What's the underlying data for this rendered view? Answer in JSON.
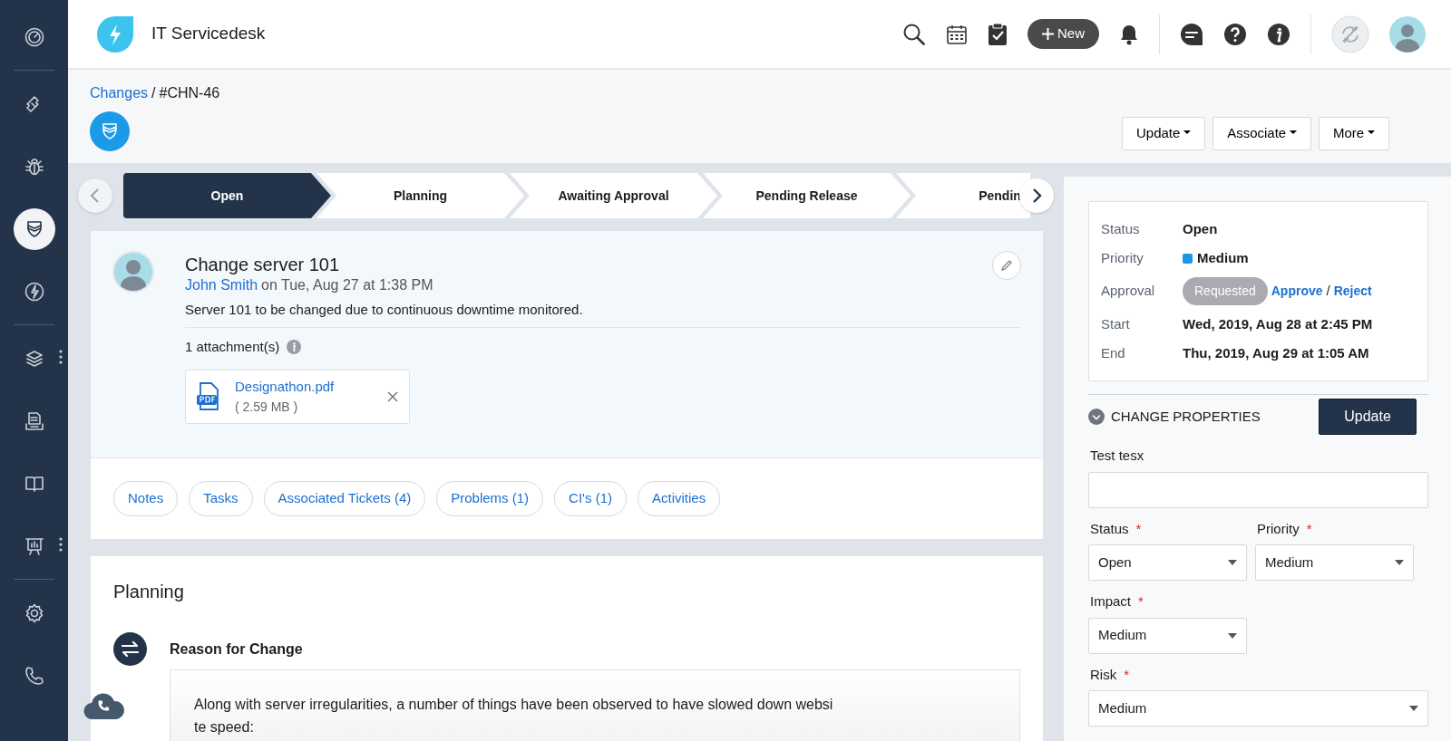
{
  "sidebar": {
    "groups": [
      {
        "items": [
          {
            "selected": false
          }
        ]
      },
      {
        "items": [
          {
            "selected": false
          },
          {
            "selected": false
          },
          {
            "selected": true
          },
          {
            "selected": false
          }
        ]
      },
      {
        "items": [
          {
            "selected": false,
            "menu_dots": true
          },
          {
            "selected": false
          },
          {
            "selected": false
          },
          {
            "selected": false,
            "menu_dots": true
          }
        ]
      },
      {
        "items": [
          {
            "selected": false
          },
          {
            "selected": false
          }
        ]
      }
    ]
  },
  "header": {
    "app_title": "IT Servicedesk",
    "new_button": "New"
  },
  "breadcrumb": {
    "link": "Changes",
    "separator": "/",
    "current": "#CHN-46"
  },
  "actions": [
    "Update",
    "Associate",
    "More"
  ],
  "stages": [
    {
      "label": "Open",
      "selected": true
    },
    {
      "label": "Planning",
      "selected": false
    },
    {
      "label": "Awaiting Approval",
      "selected": false
    },
    {
      "label": "Pending Release",
      "selected": false
    },
    {
      "label": "Pendin",
      "selected": false
    }
  ],
  "ticket": {
    "title": "Change server 101",
    "author": "John Smith",
    "meta": "on Tue, Aug 27 at 1:38 PM",
    "description": "Server 101 to be changed due to continuous downtime monitored.",
    "attachments_label": "1 attachment(s)",
    "attachment": {
      "name": "Designathon.pdf",
      "size": "( 2.59 MB )"
    }
  },
  "tabs": [
    "Notes",
    "Tasks",
    "Associated Tickets  (4)",
    "Problems (1)",
    "CI's (1)",
    "Activities"
  ],
  "planning": {
    "heading": "Planning",
    "section_title": "Reason for Change",
    "lines": [
      "Along with server irregularities, a number of things have been observed to have slowed down websi",
      "te speed:"
    ]
  },
  "summary": {
    "rows": [
      {
        "label": "Status",
        "value": "Open",
        "kind": "text"
      },
      {
        "label": "Priority",
        "value": "Medium",
        "kind": "priority",
        "color": "#1e96e6"
      },
      {
        "label": "Approval",
        "kind": "approval",
        "badge": "Requested",
        "approve": "Approve",
        "separator": "/",
        "reject": "Reject"
      },
      {
        "label": "Start",
        "value": "Wed, 2019, Aug 28 at 2:45 PM",
        "kind": "text"
      },
      {
        "label": "End",
        "value": "Thu, 2019, Aug 29 at 1:05 AM",
        "kind": "text"
      }
    ]
  },
  "properties": {
    "heading": "CHANGE PROPERTIES",
    "expanded": true,
    "update_button": "Update",
    "fields": [
      {
        "label": "Test tesx",
        "kind": "text",
        "wide": true
      },
      {
        "label": "Status",
        "kind": "select",
        "value": "Open",
        "required_mark": "*",
        "wide": false
      },
      {
        "label": "Priority",
        "kind": "select",
        "value": "Medium",
        "required_mark": "*",
        "wide": false
      },
      {
        "label": "Impact",
        "kind": "select",
        "value": "Medium",
        "required_mark": "*",
        "wide": false
      },
      {
        "label": "Risk",
        "kind": "select",
        "value": "Medium",
        "required_mark": "*",
        "wide": true
      }
    ]
  }
}
